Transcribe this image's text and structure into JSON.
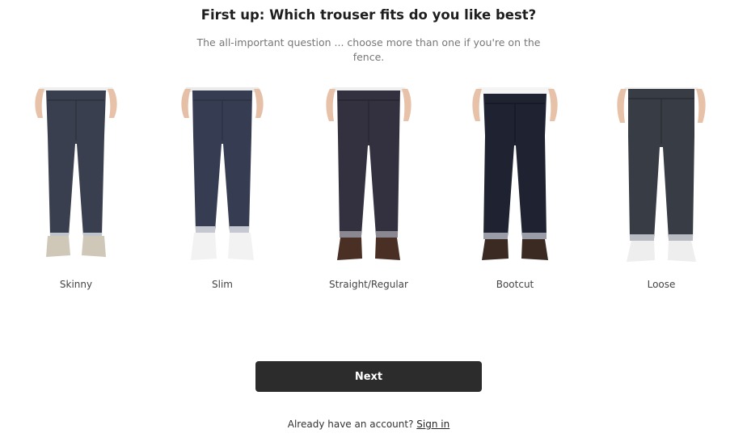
{
  "quiz": {
    "title": "First up: Which trouser fits do you like best?",
    "subtitle": "The all-important question ... choose more than one if you're on the fence."
  },
  "fits": [
    {
      "label": "Skinny",
      "denim": "#3a3f4f",
      "shoe": "#cfc8b8",
      "shirt": "#f0f0f0"
    },
    {
      "label": "Slim",
      "denim": "#363c52",
      "shoe": "#f2f2f2",
      "shirt": "#ebebeb"
    },
    {
      "label": "Straight/Regular",
      "denim": "#33313f",
      "shoe": "#4a2f25",
      "shirt": "#f0f0f0"
    },
    {
      "label": "Bootcut",
      "denim": "#1f2230",
      "shoe": "#3a2a22",
      "shirt": "#f4f4f4"
    },
    {
      "label": "Loose",
      "denim": "#383c44",
      "shoe": "#eeeeee",
      "shirt": "#f0f0f0"
    }
  ],
  "actions": {
    "next_label": "Next"
  },
  "account": {
    "prompt": "Already have an account?",
    "signin_label": "Sign in"
  }
}
